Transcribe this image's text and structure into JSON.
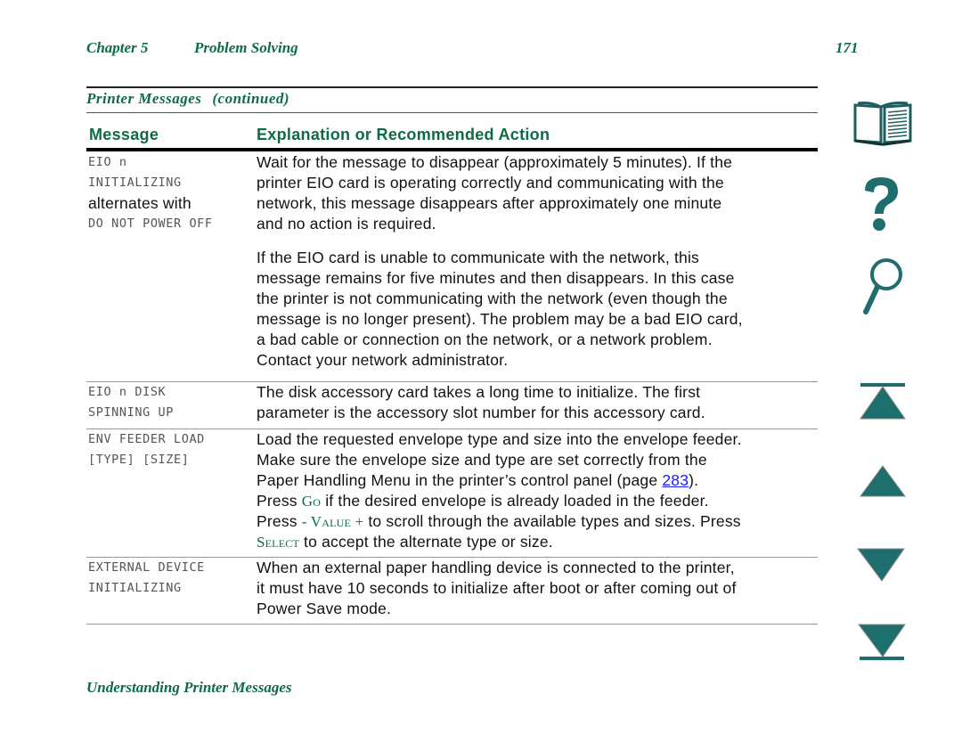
{
  "header": {
    "chapter": "Chapter 5",
    "chapter_title": "Problem Solving",
    "page_number": "171"
  },
  "section": {
    "title": "Printer Messages",
    "continued": "(continued)"
  },
  "table": {
    "columns": [
      "Message",
      "Explanation or Recommended Action"
    ],
    "rows": [
      {
        "message": [
          "EIO n",
          "INITIALIZING",
          "alternates with",
          "DO NOT POWER OFF"
        ],
        "explanation_p1": [
          "Wait for the message to disappear (approximately 5 minutes). If the",
          "printer EIO card is operating correctly and communicating with the",
          "network, this message disappears after approximately one minute",
          "and no action is required."
        ],
        "explanation_p2": [
          "If the EIO card is unable to communicate with the network, this",
          "message remains for five minutes and then disappears. In this case",
          "the printer is not communicating with the network (even though the",
          "message is no longer present). The problem may be a bad EIO card,",
          "a bad cable or connection on the network, or a network problem.",
          "Contact your network administrator."
        ]
      },
      {
        "message": [
          "EIO n DISK",
          "SPINNING UP"
        ],
        "explanation": [
          "The disk accessory card takes a long time to initialize. The first",
          "parameter is the accessory slot number for this accessory card."
        ]
      },
      {
        "message": [
          "ENV FEEDER LOAD",
          "[TYPE] [SIZE]"
        ],
        "explanation": {
          "line1": "Load the requested envelope type and size into the envelope feeder.",
          "line2": "Make sure the envelope size and type are set correctly from the",
          "line3_pre": "Paper Handling Menu in the printer’s control panel (page ",
          "line3_link": "283",
          "line3_post": ").",
          "line4_pre": "Press ",
          "line4_key": "Go",
          "line4_post": " if the desired envelope is already loaded in the feeder.",
          "line5_pre": "Press ",
          "line5_key": "- Value +",
          "line5_post": " to scroll through the available types and sizes. Press",
          "line6_key": "Select",
          "line6_post": " to accept the alternate type or size."
        }
      },
      {
        "message": [
          "EXTERNAL DEVICE",
          "INITIALIZING"
        ],
        "explanation": [
          "When an external paper handling device is connected to the printer,",
          "it must have 10 seconds to initialize after boot or after coming out of",
          "Power Save mode."
        ]
      }
    ]
  },
  "footer": {
    "text": "Understanding Printer Messages"
  },
  "nav_icons": [
    "book-icon",
    "help-question-icon",
    "search-magnifier-icon",
    "first-page-icon",
    "previous-page-icon",
    "next-page-icon",
    "last-page-icon"
  ],
  "colors": {
    "accent_green": "#0f6b45",
    "icon_teal": "#1f6e6e",
    "link_blue": "#1a1aff"
  }
}
